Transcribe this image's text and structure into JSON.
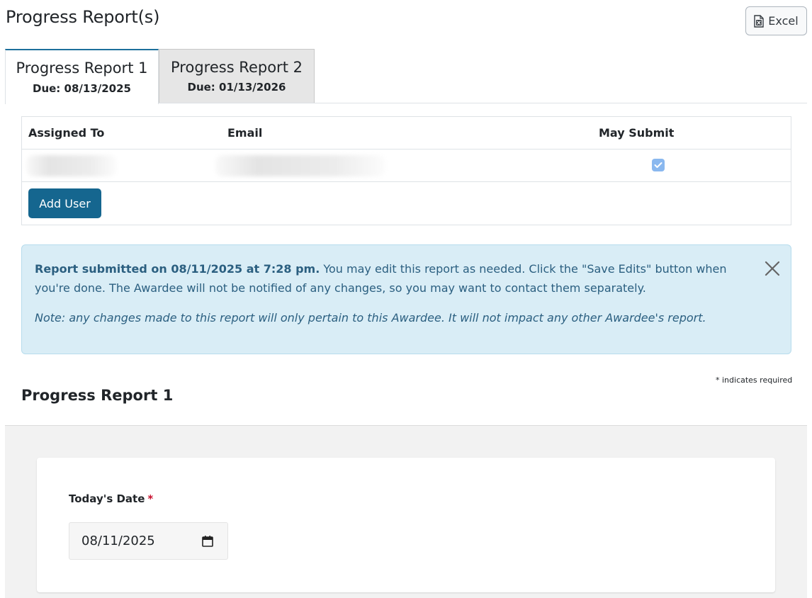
{
  "header": {
    "title": "Progress Report(s)",
    "excel_label": "Excel"
  },
  "tabs": [
    {
      "label": "Progress Report 1",
      "due": "Due: 08/13/2025",
      "active": true
    },
    {
      "label": "Progress Report 2",
      "due": "Due: 01/13/2026",
      "active": false
    }
  ],
  "users_table": {
    "columns": [
      "Assigned To",
      "Email",
      "May Submit"
    ],
    "rows": [
      {
        "assigned_to": "",
        "email": "",
        "may_submit": true
      }
    ],
    "add_user_label": "Add User"
  },
  "alert": {
    "bold": "Report submitted on 08/11/2025 at 7:28 pm.",
    "text": " You may edit this report as needed. Click the \"Save Edits\" button when you're done. The Awardee will not be notified of any changes, so you may want to contact them separately.",
    "note": "Note: any changes made to this report will only pertain to this Awardee. It will not impact any other Awardee's report."
  },
  "required_note": "* indicates required",
  "section_title": "Progress Report 1",
  "form": {
    "date_label": "Today's Date",
    "required_star": "*",
    "date_value": "08/11/2025"
  },
  "colors": {
    "primary": "#15668f",
    "alert_bg": "#d9edf6",
    "alert_text": "#2b5f80",
    "required": "#c8102e"
  }
}
